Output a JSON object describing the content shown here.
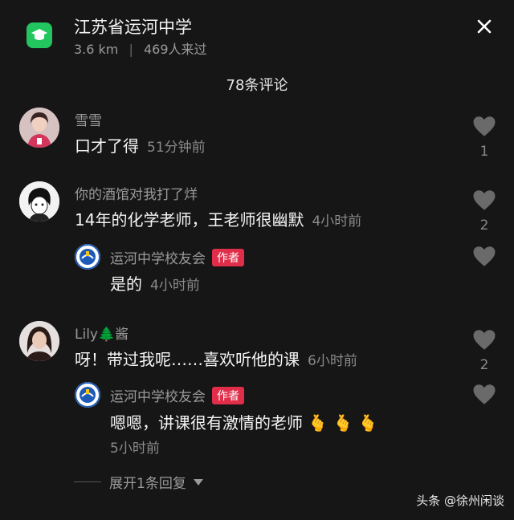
{
  "header": {
    "school_name": "江苏省运河中学",
    "distance": "3.6 km",
    "separator": "|",
    "visitors": "469人来过"
  },
  "comments_count_title": "78条评论",
  "comments": [
    {
      "username": "雪雪",
      "text": "口才了得",
      "time": "51分钟前",
      "likes": "1"
    },
    {
      "username": "你的酒馆对我打了烊",
      "text": "14年的化学老师，王老师很幽默",
      "time": "4小时前",
      "likes": "2",
      "reply": {
        "username": "运河中学校友会",
        "badge": "作者",
        "text": "是的",
        "time": "4小时前"
      }
    },
    {
      "username": "Lily🌲酱",
      "text": "呀！带过我呢……喜欢听他的课",
      "time": "6小时前",
      "likes": "2",
      "reply": {
        "username": "运河中学校友会",
        "badge": "作者",
        "text": "嗯嗯，讲课很有激情的老师 🫰 🫰 🫰",
        "time": "5小时前"
      }
    }
  ],
  "expand_label": "展开1条回复",
  "watermark": "头条 @徐州闲谈",
  "colors": {
    "background": "#161616",
    "badge": "#e02e4a",
    "school_icon": "#22c55e"
  }
}
